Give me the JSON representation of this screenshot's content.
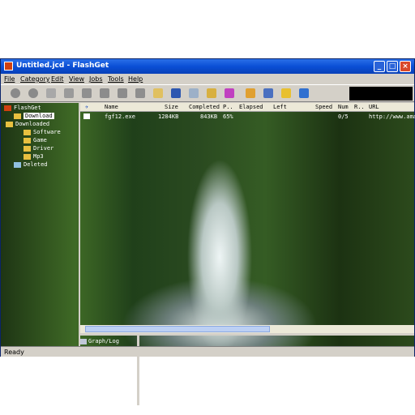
{
  "window": {
    "title": "Untitled.jcd - FlashGet"
  },
  "menu": [
    "File",
    "Category",
    "Edit",
    "View",
    "Jobs",
    "Tools",
    "Help"
  ],
  "toolbar_icons": [
    "start-icon",
    "pause-icon",
    "new-icon",
    "delete-icon",
    "properties-icon",
    "move-up-icon",
    "move-down-icon",
    "open-folder-icon",
    "open-icon",
    "find-icon",
    "connect-icon",
    "dial-icon",
    "drop-zone-icon",
    "options-icon",
    "site-manager-icon",
    "help-icon",
    "exit-icon"
  ],
  "tree": {
    "root": "FlashGet",
    "download": "Download",
    "downloaded": "Downloaded",
    "children": [
      "Software",
      "Game",
      "Driver",
      "Mp3"
    ],
    "deleted": "Deleted"
  },
  "table": {
    "headers": [
      "Name",
      "Size",
      "Completed",
      "P..",
      "Elapsed",
      "Left",
      "Speed",
      "Num",
      "R..",
      "URL"
    ],
    "rows": [
      {
        "name": "fgf12.exe",
        "size": "1284KB",
        "completed": "843KB",
        "percent": "65%",
        "elapsed": "",
        "left": "",
        "speed": "",
        "num": "0/5",
        "r": "",
        "url": "http://www.amaz"
      }
    ]
  },
  "lower_panel": {
    "label": "Graph/Log"
  },
  "status": {
    "text": "Ready"
  },
  "colors": {
    "title_bar": "#0a4fd6",
    "chrome": "#d4d0c8"
  }
}
